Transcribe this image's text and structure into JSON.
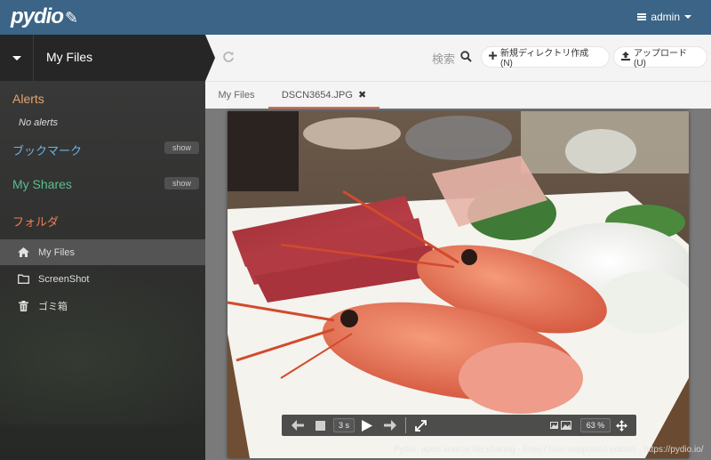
{
  "app": {
    "logo_text": "pydio",
    "user_label": "admin"
  },
  "workspace": {
    "title": "My Files"
  },
  "sidebar": {
    "alerts_title": "Alerts",
    "no_alerts": "No alerts",
    "bookmarks_title": "ブックマーク",
    "bookmarks_show": "show",
    "shares_title": "My Shares",
    "shares_show": "show",
    "folders_title": "フォルダ",
    "items": [
      {
        "label": "My Files",
        "icon": "home-icon",
        "active": true
      },
      {
        "label": "ScreenShot",
        "icon": "folder-icon",
        "active": false
      },
      {
        "label": "ゴミ箱",
        "icon": "trash-icon",
        "active": false
      }
    ]
  },
  "toolbar": {
    "search_label": "検索",
    "new_dir_label": "新規ディレクトリ作成(N)",
    "upload_label": "アップロード(U)"
  },
  "tabs": [
    {
      "label": "My Files",
      "active": false
    },
    {
      "label": "DSCN3654.JPG",
      "active": true
    }
  ],
  "viewer": {
    "speed": "3 s",
    "zoom": "63 %"
  },
  "footer": {
    "text": "Pydio, open source file sharing - Free / Non supported edition - https://pydio.io/"
  },
  "colors": {
    "topbar": "#3b6486",
    "alerts": "#e9a26c",
    "bookmarks": "#6eb3e6",
    "shares": "#5dbd90",
    "folders": "#ef7a57",
    "active_tab_underline": "#e06a4c"
  }
}
